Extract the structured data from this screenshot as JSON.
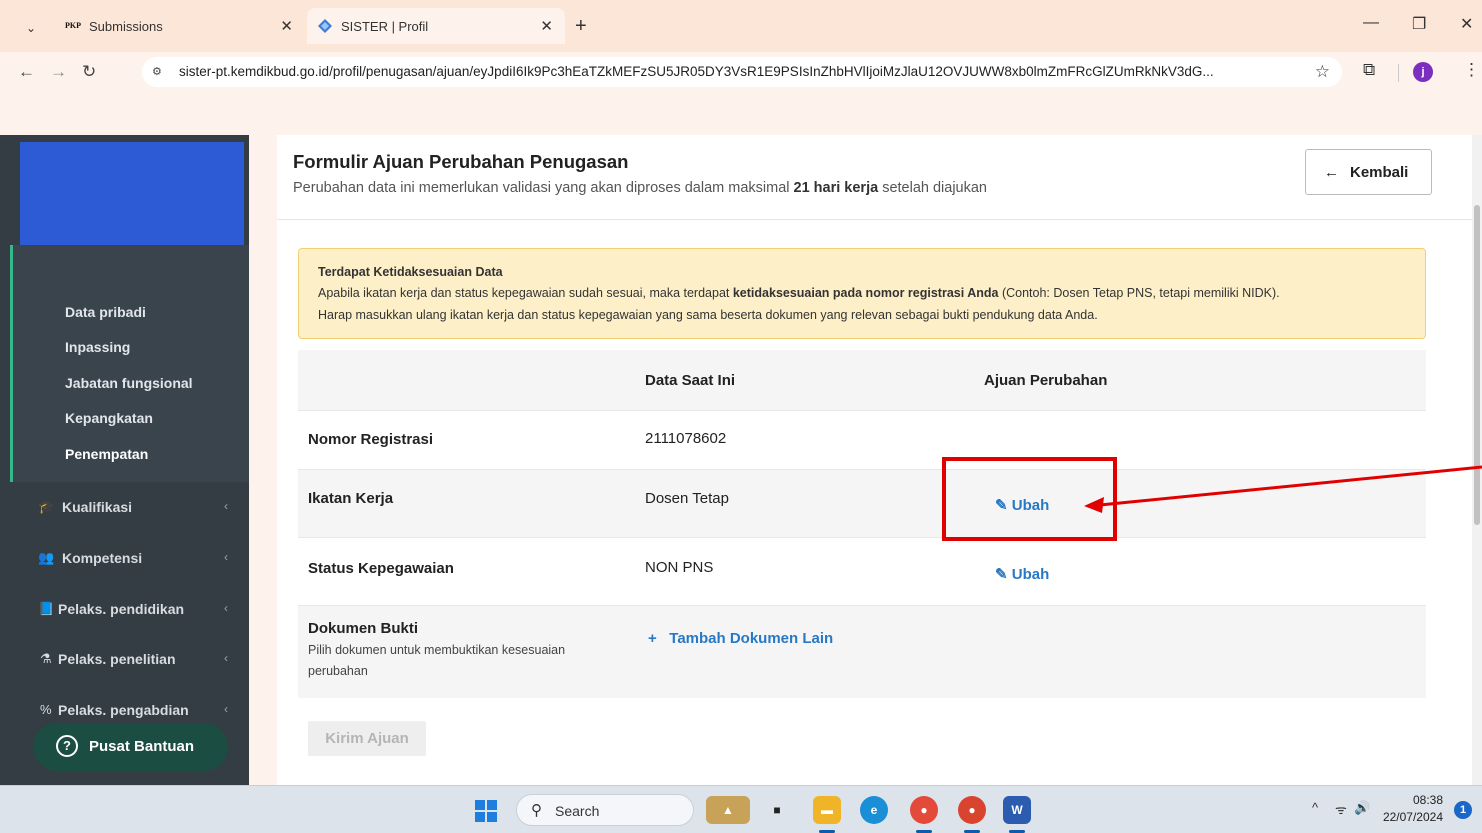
{
  "browser": {
    "tabs": [
      {
        "title": "Submissions",
        "favicon": "PKP",
        "active": false
      },
      {
        "title": "SISTER | Profil",
        "active": true
      }
    ],
    "url": "sister-pt.kemdikbud.go.id/profil/penugasan/ajuan/eyJpdiI6Ik9Pc3hEaTZkMEFzSU5JR05DY3VsR1E9PSIsInZhbHVlIjoiMzJlaU12OVJUWW8xb0lmZmFRcGlZUmRkNkV3dG...",
    "profile_initial": "j"
  },
  "sidebar": {
    "sub_items": [
      "Data pribadi",
      "Inpassing",
      "Jabatan fungsional",
      "Kepangkatan",
      "Penempatan"
    ],
    "items": [
      {
        "label": "Kualifikasi",
        "icon": "graduation-cap-icon",
        "glyph": "🎓"
      },
      {
        "label": "Kompetensi",
        "icon": "people-icon",
        "glyph": "👥"
      },
      {
        "label": "Pelaks. pendidikan",
        "icon": "book-icon",
        "glyph": "📘"
      },
      {
        "label": "Pelaks. penelitian",
        "icon": "flask-icon",
        "glyph": "⚗"
      },
      {
        "label": "Pelaks. pengabdian",
        "icon": "percent-icon",
        "glyph": "%"
      }
    ],
    "help_label": "Pusat Bantuan"
  },
  "header": {
    "title": "Formulir Ajuan Perubahan Penugasan",
    "subtitle_pre": "Perubahan data ini memerlukan validasi yang akan diproses dalam maksimal ",
    "subtitle_bold": "21 hari kerja",
    "subtitle_post": " setelah diajukan",
    "back_label": "Kembali"
  },
  "alert": {
    "title": "Terdapat Ketidaksesuaian Data",
    "line1_pre": "Apabila ikatan kerja dan status kepegawaian sudah sesuai, maka terdapat ",
    "line1_bold": "ketidaksesuaian pada nomor registrasi Anda",
    "line1_post": " (Contoh: Dosen Tetap PNS, tetapi memiliki NIDK).",
    "line2": "Harap masukkan ulang ikatan kerja dan status kepegawaian yang sama beserta dokumen yang relevan sebagai bukti pendukung data Anda."
  },
  "table": {
    "col_current": "Data Saat Ini",
    "col_proposed": "Ajuan Perubahan",
    "rows": [
      {
        "label": "Nomor Registrasi",
        "value": "2111078602"
      },
      {
        "label": "Ikatan Kerja",
        "value": "Dosen Tetap",
        "action": "Ubah"
      },
      {
        "label": "Status Kepegawaian",
        "value": "NON PNS",
        "action": "Ubah"
      }
    ],
    "doc_label": "Dokumen Bukti",
    "doc_note_line1": "Pilih dokumen untuk membuktikan kesesuaian",
    "doc_note_line2": "perubahan",
    "add_doc_label": "Tambah Dokumen Lain"
  },
  "submit_label": "Kirim Ajuan",
  "taskbar": {
    "search_label": "Search",
    "time": "08:38",
    "date": "22/07/2024",
    "notification_count": "1"
  },
  "colors": {
    "link": "#2878c5",
    "sidebar": "#343c44",
    "alert_bg": "#fdf0c8",
    "annotation": "#e10000"
  }
}
